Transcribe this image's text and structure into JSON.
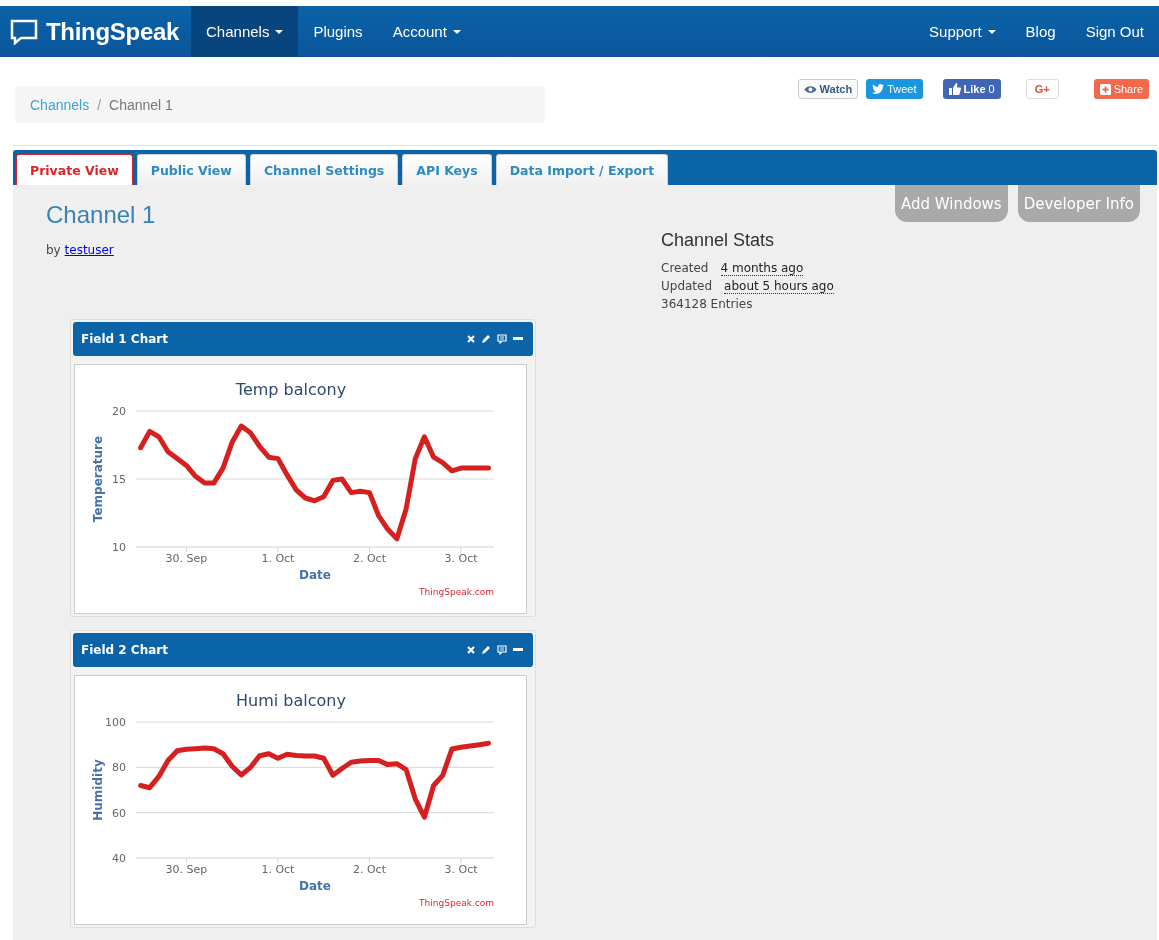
{
  "navbar": {
    "brand": "ThingSpeak",
    "left_items": [
      {
        "label": "Channels",
        "selected": true,
        "dropdown": true
      },
      {
        "label": "Plugins",
        "selected": false,
        "dropdown": false
      },
      {
        "label": "Account",
        "selected": false,
        "dropdown": true
      }
    ],
    "right_items": [
      {
        "label": "Support",
        "selected": false,
        "dropdown": true
      },
      {
        "label": "Blog",
        "selected": false,
        "dropdown": false
      },
      {
        "label": "Sign Out",
        "selected": false,
        "dropdown": false
      }
    ]
  },
  "breadcrumb": {
    "separator": "/",
    "items": [
      {
        "label": "Channels",
        "kind": "link"
      },
      {
        "label": "Channel 1",
        "kind": "current"
      }
    ]
  },
  "social_buttons": [
    {
      "kind": "watch",
      "label": "Watch"
    },
    {
      "kind": "tweet",
      "label": "Tweet"
    },
    {
      "kind": "like",
      "label": "Like",
      "count": "0"
    },
    {
      "kind": "gplus",
      "label": "G+"
    },
    {
      "kind": "share",
      "label": "Share"
    }
  ],
  "tabs": [
    {
      "label": "Private View",
      "selected": true
    },
    {
      "label": "Public View",
      "selected": false
    },
    {
      "label": "Channel Settings",
      "selected": false
    },
    {
      "label": "API Keys",
      "selected": false
    },
    {
      "label": "Data Import / Export",
      "selected": false
    }
  ],
  "channel": {
    "title": "Channel 1",
    "by": "by",
    "owner": "testuser"
  },
  "action_buttons": [
    "Add Windows",
    "Developer Info"
  ],
  "stats": {
    "title": "Channel Stats",
    "rows": [
      {
        "label": "Created",
        "value": "4 months ago"
      },
      {
        "label": "Updated",
        "value": "about 5 hours ago"
      }
    ],
    "entries": "364128 Entries"
  },
  "windows": [
    {
      "title": "Field 1 Chart",
      "credit": "ThingSpeak.com",
      "chart_data": {
        "type": "line",
        "title": "Temp balcony",
        "xlabel": "Date",
        "ylabel": "Temperature",
        "categories": [
          null,
          null,
          null,
          null,
          null,
          "30. Sep",
          null,
          null,
          null,
          null,
          null,
          null,
          null,
          null,
          null,
          "1. Oct",
          null,
          null,
          null,
          null,
          null,
          null,
          null,
          null,
          null,
          "2. Oct",
          null,
          null,
          null,
          null,
          null,
          null,
          null,
          null,
          null,
          "3. Oct",
          null,
          null,
          null
        ],
        "series": [
          {
            "color": "#d62020",
            "values": [
              17.3,
              18.5,
              18.1,
              17.0,
              16.5,
              16.0,
              15.2,
              14.7,
              14.7,
              15.8,
              17.7,
              18.9,
              18.4,
              17.4,
              16.6,
              16.5,
              15.3,
              14.2,
              13.6,
              13.4,
              13.7,
              14.9,
              15.0,
              14.0,
              14.1,
              14.0,
              12.3,
              11.3,
              10.6,
              12.8,
              16.5,
              18.1,
              16.6,
              16.2,
              15.6,
              15.8,
              15.8,
              15.8,
              15.8
            ]
          }
        ],
        "ylim": [
          10,
          20
        ],
        "yticks": [
          10,
          15,
          20
        ]
      }
    },
    {
      "title": "Field 2 Chart",
      "credit": "ThingSpeak.com",
      "chart_data": {
        "type": "line",
        "title": "Humi balcony",
        "xlabel": "Date",
        "ylabel": "Humidity",
        "categories": [
          null,
          null,
          null,
          null,
          null,
          "30. Sep",
          null,
          null,
          null,
          null,
          null,
          null,
          null,
          null,
          null,
          "1. Oct",
          null,
          null,
          null,
          null,
          null,
          null,
          null,
          null,
          null,
          "2. Oct",
          null,
          null,
          null,
          null,
          null,
          null,
          null,
          null,
          null,
          "3. Oct",
          null,
          null,
          null
        ],
        "series": [
          {
            "color": "#d62020",
            "values": [
              72,
              71,
              76,
              83,
              87.3,
              88,
              88.2,
              88.5,
              88.2,
              86,
              80.5,
              76.6,
              80,
              85.1,
              86,
              84,
              85.8,
              85.2,
              85,
              85,
              84,
              76.5,
              79.5,
              82.2,
              82.8,
              83,
              83,
              81.2,
              81.6,
              79,
              66,
              58,
              72,
              76.5,
              88.1,
              88.9,
              89.4,
              90,
              90.6
            ]
          }
        ],
        "ylim": [
          40,
          100
        ],
        "yticks": [
          40,
          60,
          80,
          100
        ]
      }
    }
  ]
}
